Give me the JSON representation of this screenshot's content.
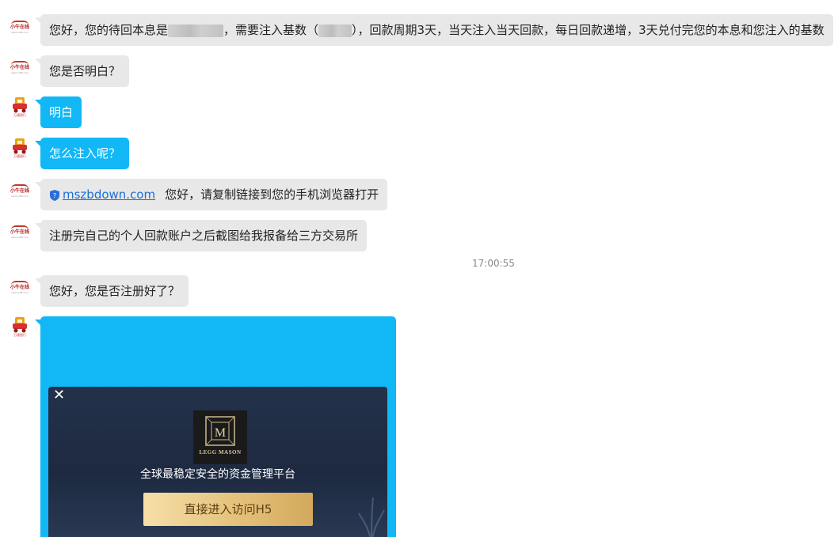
{
  "messages": [
    {
      "side": "in",
      "pre": "您好，您的待回本息是",
      "mid": "，需要注入基数（",
      "post": "），回款周期3天，当天注入当天回款，每日回款递增，3天兑付完您的本息和您注入的基数"
    },
    {
      "side": "in",
      "text": "您是否明白？"
    },
    {
      "side": "out",
      "text": "明白"
    },
    {
      "side": "out",
      "text": "怎么注入呢？"
    },
    {
      "side": "in",
      "link": "mszbdown.com",
      "text": "您好，请复制链接到您的手机浏览器打开"
    },
    {
      "side": "in",
      "text": "注册完自己的个人回款账户之后截图给我报备给三方交易所"
    },
    {
      "side": "in",
      "text": "您好，您是否注册好了？"
    }
  ],
  "timestamp": "17:00:55",
  "avatar_logo": {
    "text": "小牛在线",
    "sub": "xiaoniu88.com",
    "color": "#b32020"
  },
  "avatar_user": {
    "label": "万通银行"
  },
  "image_message": {
    "close_symbol": "✕",
    "brand_letter": "M",
    "brand_name": "LEGG MASON",
    "tagline": "全球最稳定安全的资金管理平台",
    "cta": "直接进入访问H5"
  },
  "colors": {
    "incoming": "#e8e8e8",
    "outgoing": "#12b7f5",
    "link": "#1a6fd6"
  }
}
